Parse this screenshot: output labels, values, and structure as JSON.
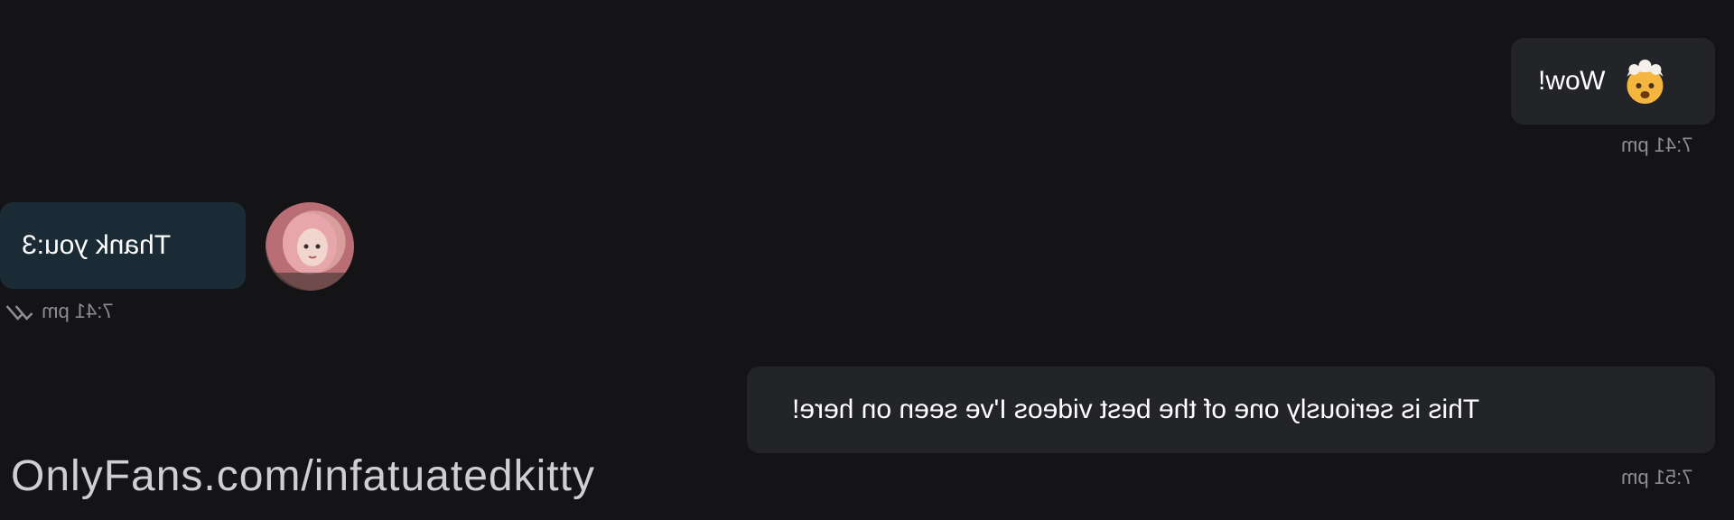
{
  "messages": [
    {
      "direction": "outgoing",
      "text": "Wow!",
      "emoji": "exploding-head",
      "time": "7:41 pm"
    },
    {
      "direction": "incoming",
      "text": "Thank you:3",
      "time": "7:41 pm",
      "status": "read-double-check"
    },
    {
      "direction": "outgoing",
      "text": "This is seriously one of the best videos I've seen on here!",
      "time": "7:51 pm"
    }
  ],
  "watermark": "OnlyFans.com/infatuatedkitty",
  "colors": {
    "background": "#141416",
    "outgoing_bubble": "#232428",
    "incoming_bubble": "#1a2b36",
    "timestamp": "#8c8e94"
  }
}
